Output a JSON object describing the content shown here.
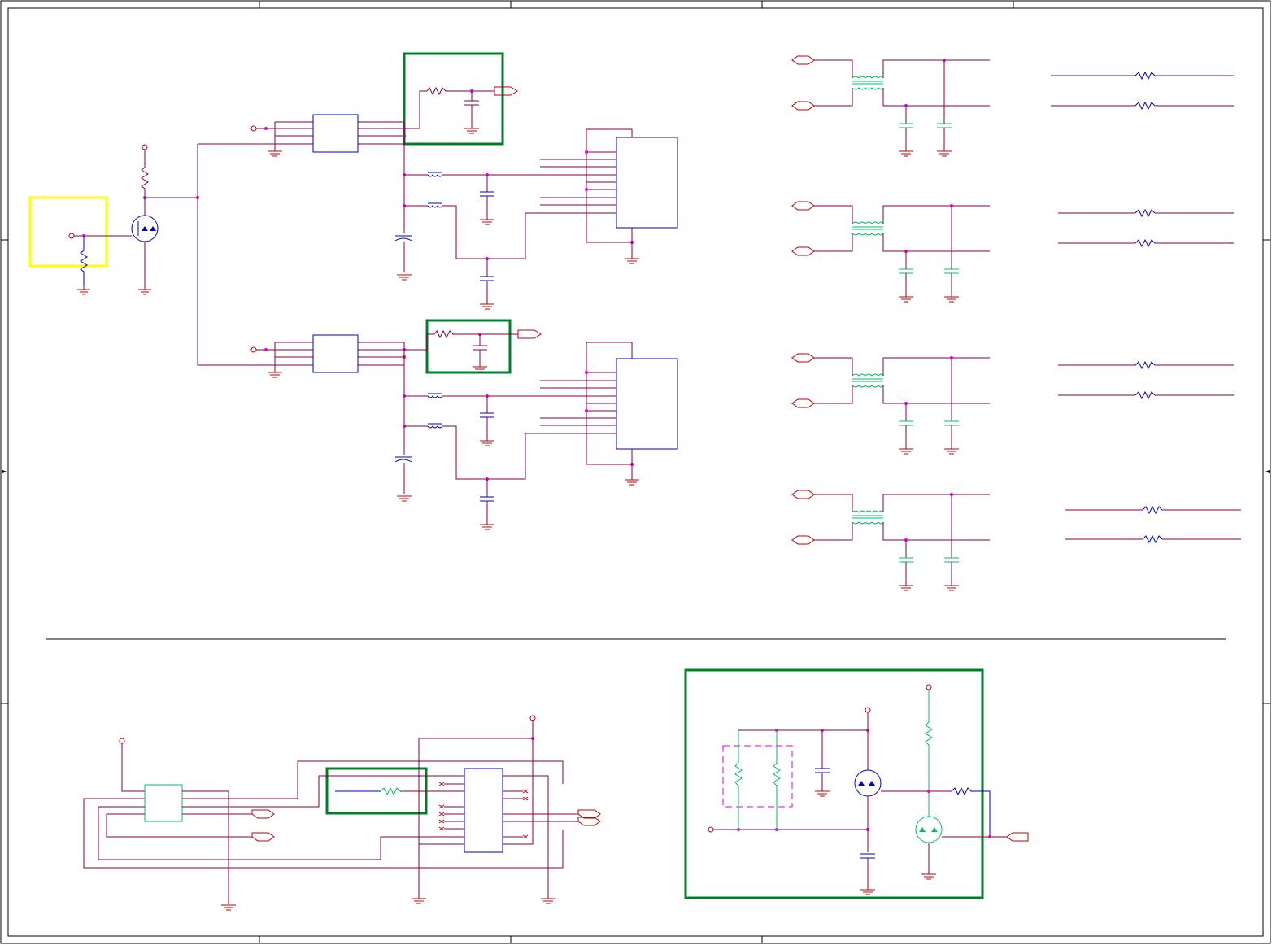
{
  "diagram": {
    "type": "schematic",
    "colors": {
      "wire": "#800040",
      "component_red": "#c00000",
      "component_blue": "#0000c0",
      "component_green": "#00c060",
      "junction": "#e000e0",
      "highlight_yellow": "#ffff00",
      "highlight_green": "#007f2a",
      "border": "#000000"
    },
    "highlights": [
      "yellow-box",
      "green-box"
    ],
    "sections": [
      "gate-driver-block",
      "upper-ic-channel",
      "lower-ic-channel",
      "common-mode-filter-channels",
      "series-resistor-channels",
      "connector-block",
      "power-switch-block"
    ]
  }
}
